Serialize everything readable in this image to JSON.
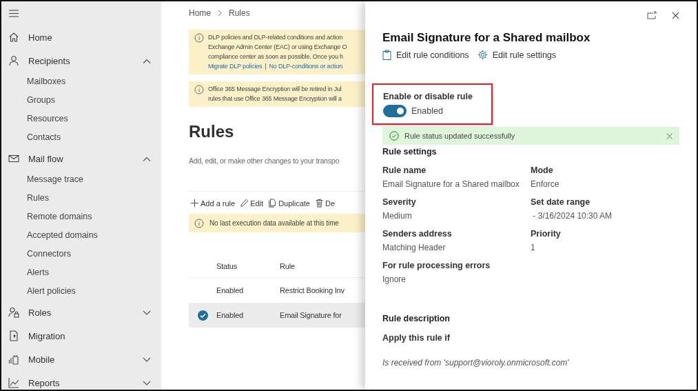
{
  "sidebar": {
    "items": [
      {
        "label": "Home"
      },
      {
        "label": "Recipients",
        "expanded": true,
        "children": [
          {
            "label": "Mailboxes"
          },
          {
            "label": "Groups"
          },
          {
            "label": "Resources"
          },
          {
            "label": "Contacts"
          }
        ]
      },
      {
        "label": "Mail flow",
        "expanded": true,
        "children": [
          {
            "label": "Message trace"
          },
          {
            "label": "Rules"
          },
          {
            "label": "Remote domains"
          },
          {
            "label": "Accepted domains"
          },
          {
            "label": "Connectors"
          },
          {
            "label": "Alerts"
          },
          {
            "label": "Alert policies"
          }
        ]
      },
      {
        "label": "Roles",
        "expanded": false
      },
      {
        "label": "Migration"
      },
      {
        "label": "Mobile",
        "expanded": false
      },
      {
        "label": "Reports",
        "expanded": false
      }
    ]
  },
  "breadcrumb": [
    "Home",
    "Rules"
  ],
  "banners": [
    {
      "lines": [
        "DLP policies and DLP-related conditions and action",
        "Exchange Admin Center (EAC) or using Exchange O",
        "compliance center as soon as possible. Once you h"
      ],
      "links": [
        "Migrate DLP policies",
        "No DLP-conditions or action"
      ],
      "separator": "|"
    },
    {
      "lines": [
        "Office 365 Message Encryption will be retired in Jul",
        "rules that use Office 365 Message Encryption will a"
      ]
    }
  ],
  "page": {
    "title": "Rules",
    "description": "Add, edit, or make other changes to your transpo"
  },
  "toolbar": [
    {
      "label": "Add a rule"
    },
    {
      "label": "Edit"
    },
    {
      "label": "Duplicate"
    },
    {
      "label": "De"
    }
  ],
  "notice": "No last execution data available at this time",
  "table": {
    "columns": [
      "Status",
      "Rule"
    ],
    "rows": [
      {
        "status": "Enabled",
        "rule": "Restrict Booking Inv",
        "selected": false
      },
      {
        "status": "Enabled",
        "rule": "Email Signature for",
        "selected": true
      }
    ]
  },
  "panel": {
    "title": "Email Signature for a Shared mailbox",
    "actions": [
      {
        "label": "Edit rule conditions"
      },
      {
        "label": "Edit rule settings"
      }
    ],
    "toggle": {
      "label": "Enable or disable rule",
      "on": true,
      "state_text": "Enabled",
      "highlighted": true
    },
    "message": "Rule status updated successfully",
    "settings_heading": "Rule settings",
    "fields": [
      {
        "label": "Rule name",
        "value": "Email Signature for a Shared mailbox"
      },
      {
        "label": "Mode",
        "value": "Enforce"
      },
      {
        "label": "Severity",
        "value": "Medium"
      },
      {
        "label": "Set date range",
        "value": " - 3/16/2024 10:30 AM"
      },
      {
        "label": "Senders address",
        "value": "Matching Header"
      },
      {
        "label": "Priority",
        "value": "1"
      },
      {
        "label": "For rule processing errors",
        "value": "Ignore"
      }
    ],
    "description_heading": "Rule description",
    "condition_heading": "Apply this rule if",
    "condition": "Is received from 'support@vioroly.onmicrosoft.com'"
  }
}
